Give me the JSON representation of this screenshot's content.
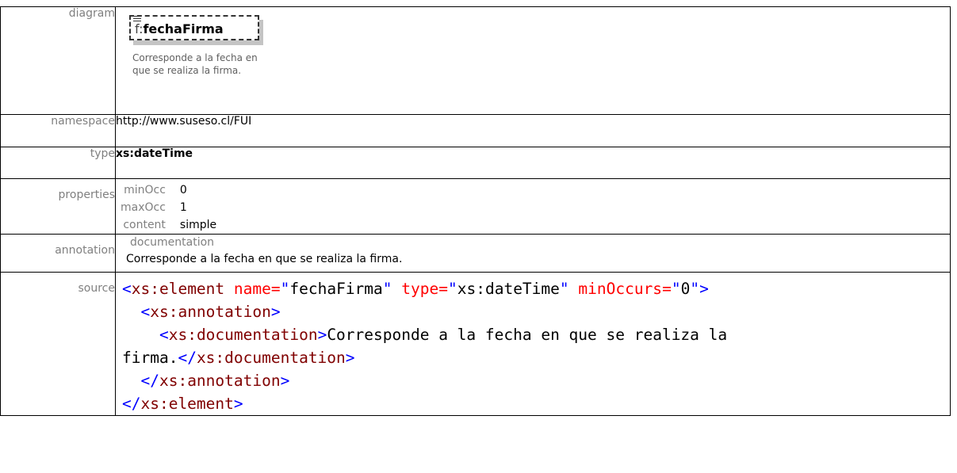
{
  "labels": {
    "diagram": "diagram",
    "namespace": "namespace",
    "type": "type",
    "properties": "properties",
    "annotation": "annotation",
    "source": "source"
  },
  "diagram": {
    "element_prefix": "f:",
    "element_name": "fechaFirma",
    "documentation_line1": "Corresponde a la fecha en",
    "documentation_line2": "que se realiza la firma."
  },
  "namespace": "http://www.suseso.cl/FUI",
  "type": "xs:dateTime",
  "properties": [
    {
      "key": "minOcc",
      "value": "0"
    },
    {
      "key": "maxOcc",
      "value": "1"
    },
    {
      "key": "content",
      "value": "simple"
    }
  ],
  "annotation": {
    "key": "documentation",
    "text": "Corresponde a la fecha en que se realiza la firma."
  },
  "source": {
    "lines": [
      "<xs:element name=\"fechaFirma\" type=\"xs:dateTime\" minOccurs=\"0\">",
      "  <xs:annotation>",
      "    <xs:documentation>Corresponde a la fecha en que se realiza la",
      "firma.</xs:documentation>",
      "  </xs:annotation>",
      "</xs:element>"
    ]
  },
  "colors": {
    "tag": "#0000ff",
    "element_name": "#800000",
    "attribute": "#ff0000",
    "label": "#808080"
  }
}
